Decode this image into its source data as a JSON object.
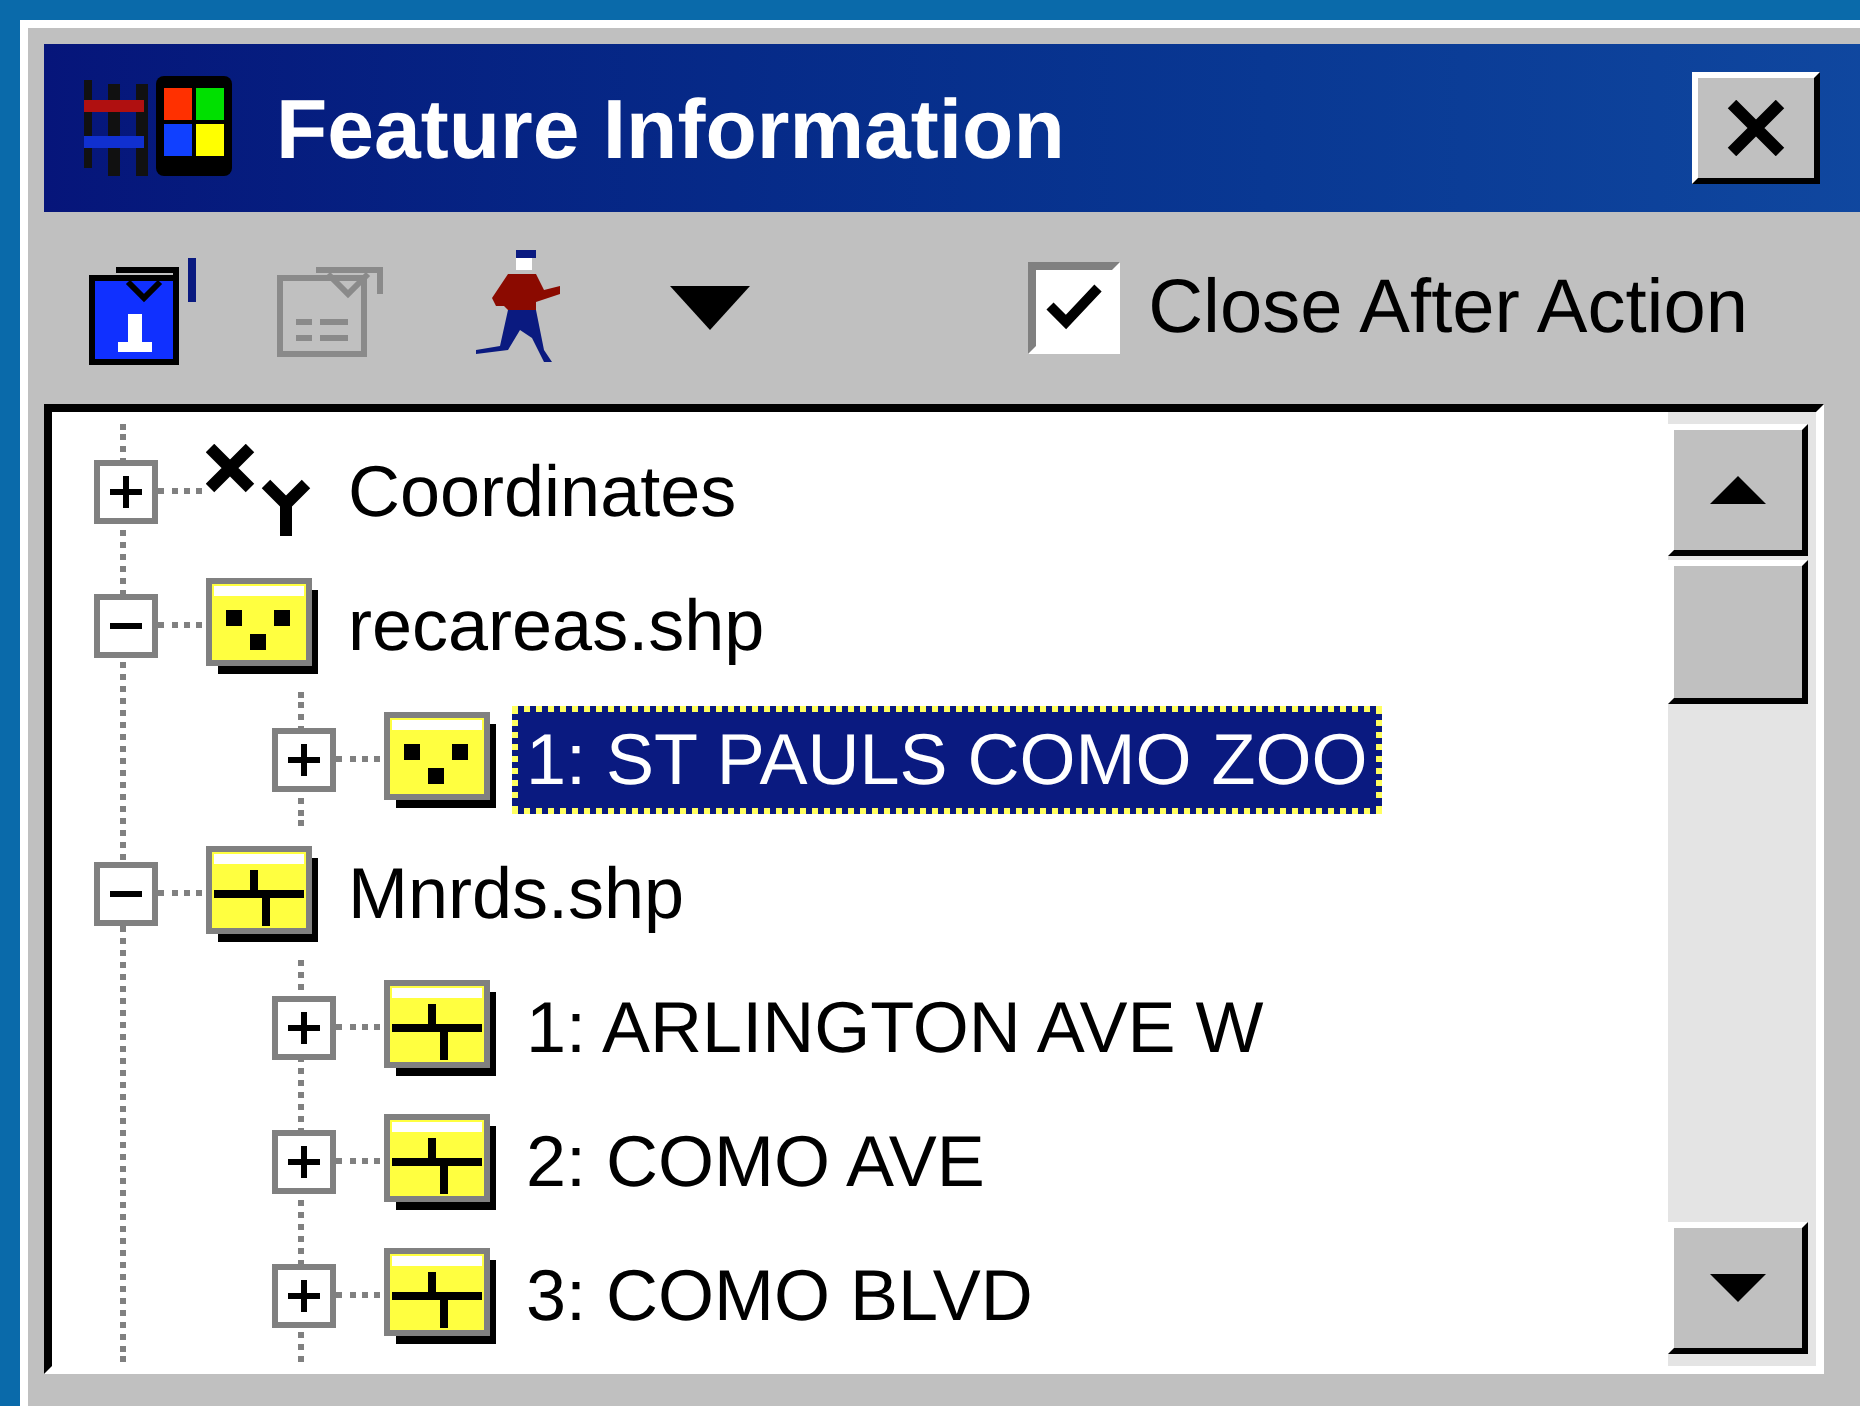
{
  "window": {
    "title": "Feature Information"
  },
  "toolbar": [
    {
      "kind": "identify",
      "disabled": false
    },
    {
      "kind": "form",
      "disabled": true
    },
    {
      "kind": "action",
      "disabled": false
    },
    {
      "kind": "menu",
      "disabled": false
    }
  ],
  "close_after_action": {
    "label": "Close After Action",
    "checked": true
  },
  "tree": [
    {
      "kind": "coordinates",
      "label": "Coordinates",
      "expanded": false,
      "selected": false
    },
    {
      "kind": "point-layer",
      "label": "recareas.shp",
      "expanded": true,
      "selected": false,
      "children": [
        {
          "kind": "point-layer",
          "label": "1: ST PAULS COMO ZOO",
          "expanded": false,
          "selected": true
        }
      ]
    },
    {
      "kind": "line-layer",
      "label": "Mnrds.shp",
      "expanded": true,
      "selected": false,
      "children": [
        {
          "kind": "line-layer",
          "label": "1: ARLINGTON AVE W",
          "expanded": false,
          "selected": false
        },
        {
          "kind": "line-layer",
          "label": "2: COMO AVE",
          "expanded": false,
          "selected": false
        },
        {
          "kind": "line-layer",
          "label": "3: COMO BLVD",
          "expanded": false,
          "selected": false
        }
      ]
    }
  ]
}
